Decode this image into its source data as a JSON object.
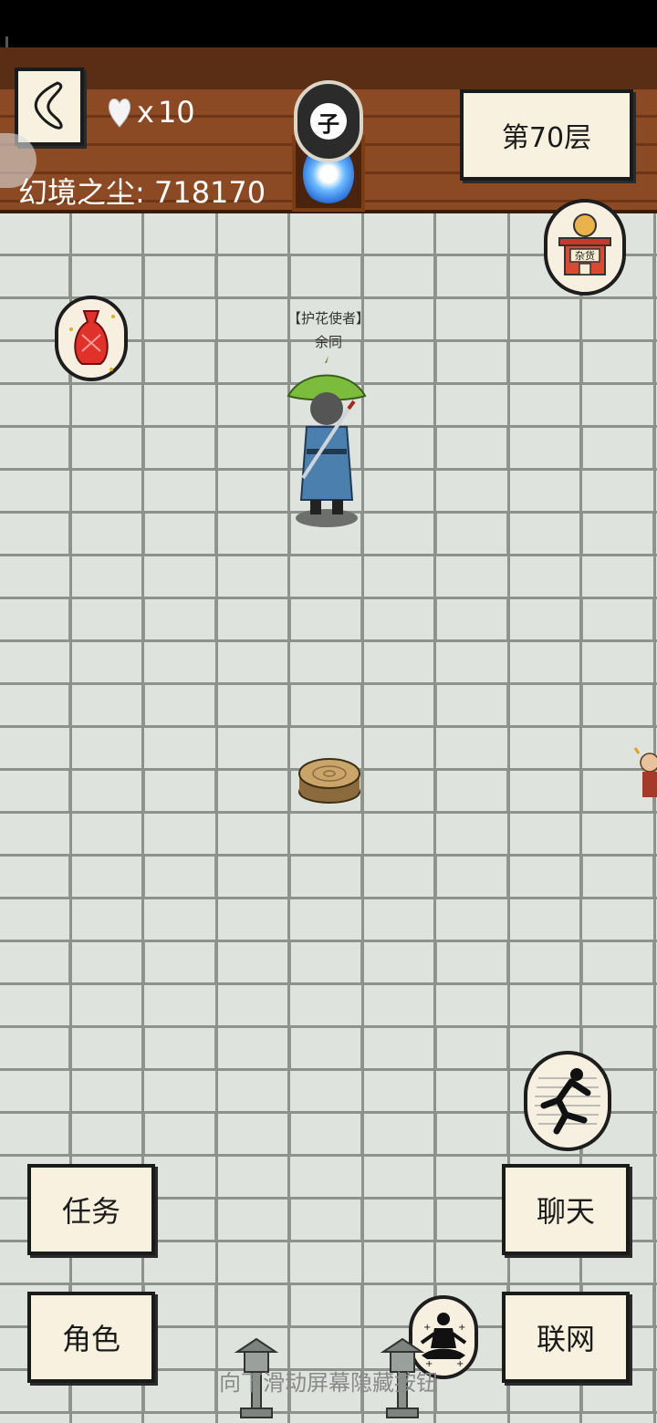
{
  "hud": {
    "lives_prefix": "x",
    "lives": "10",
    "dust_label": "幻境之尘:",
    "dust_value": "718170",
    "time_char": "子",
    "floor_label": "第70层"
  },
  "npc": {
    "title": "【护花使者】",
    "name": "余同"
  },
  "icons": {
    "back": "back-arrow-icon",
    "heart": "heart-icon",
    "clock": "day-time-icon",
    "portal": "portal-icon",
    "shop": "shop-icon",
    "shop_label": "杂货",
    "bag": "red-bag-icon",
    "run": "run-icon",
    "meditate": "meditate-icon"
  },
  "buttons": {
    "task": "任务",
    "role": "角色",
    "chat": "聊天",
    "network": "联网"
  },
  "hint": "向下滑动屏幕隐藏按钮"
}
